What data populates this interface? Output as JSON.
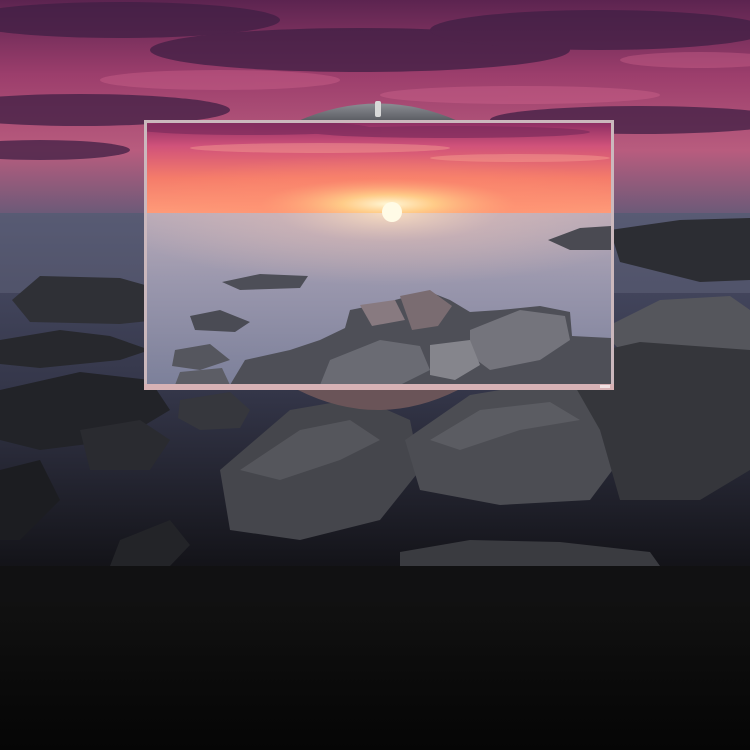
{
  "scene": {
    "subject": "monitor-on-seascape-sunset",
    "colors": {
      "sky_top": "#6b2a5a",
      "sky_mid": "#c4527e",
      "sky_low": "#f07a63",
      "sun": "#fff3c8",
      "sea": "#6a6f86",
      "rock_dark": "#2b2c31",
      "rock_light": "#5a5a60",
      "frame": "#d7b7b7",
      "bottom_band": "#0a0a0a"
    }
  }
}
